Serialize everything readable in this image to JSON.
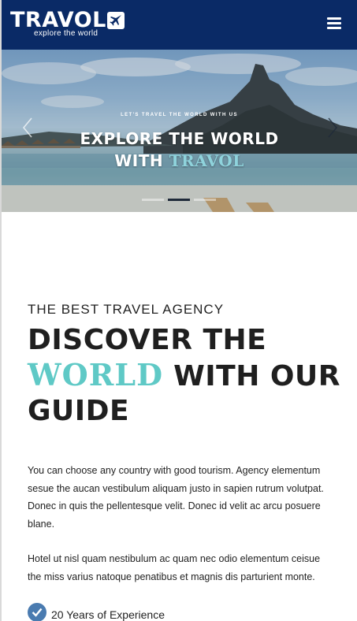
{
  "brand": {
    "name": "TRAVOL",
    "tagline": "explore the world"
  },
  "hero": {
    "kicker": "LET'S TRAVEL THE WORLD WITH US",
    "line1": "EXPLORE THE WORLD",
    "line2_prefix": "WITH",
    "line2_brand": "TRAVOL",
    "active_slide": 2,
    "slide_count": 3
  },
  "about": {
    "kicker": "THE BEST TRAVEL AGENCY",
    "heading_line1": "DISCOVER THE",
    "heading_highlight": "WORLD",
    "heading_line2_rest": "WITH OUR",
    "heading_line3": "GUIDE",
    "paragraph1": "You can choose any country with good tourism. Agency elementum sesue the aucan vestibulum aliquam justo in sapien rutrum volutpat. Donec in quis the pellentesque velit. Donec id velit ac arcu posuere blane.",
    "paragraph2": "Hotel ut nisl quam nestibulum ac quam nec odio elementum ceisue the miss varius natoque penatibus et magnis dis parturient monte.",
    "features": [
      {
        "label": "20 Years of Experience",
        "icon": "check-circle-icon"
      }
    ]
  },
  "colors": {
    "header_bg": "#0a2a66",
    "highlight": "#5fc9c6",
    "check": "#4a7bb0"
  }
}
